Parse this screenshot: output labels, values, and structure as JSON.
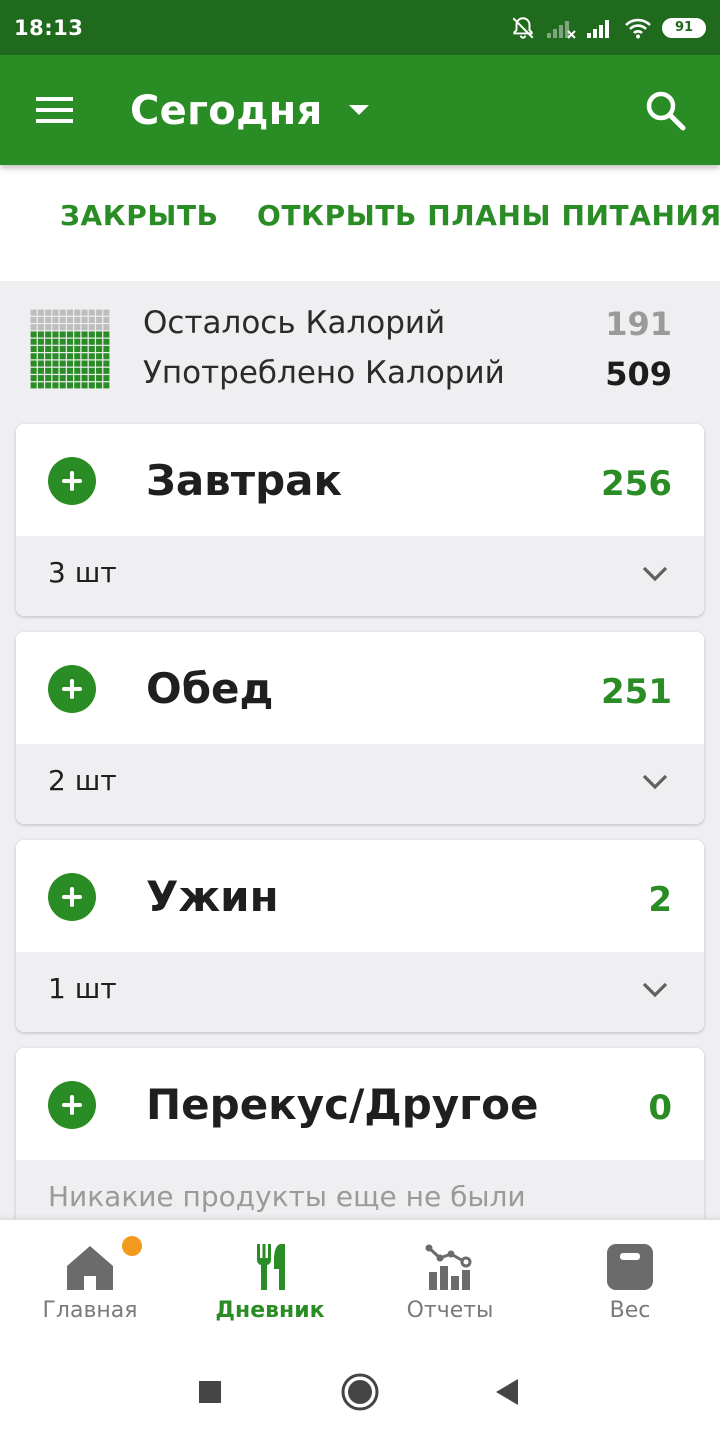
{
  "status_bar": {
    "time": "18:13",
    "battery": "91",
    "icons": [
      "bell-off-icon",
      "signal-weak-icon",
      "signal-icon",
      "wifi-icon",
      "battery-icon"
    ]
  },
  "app_bar": {
    "title": "Сегодня",
    "icons": [
      "menu-icon",
      "dropdown-arrow-icon",
      "search-icon"
    ]
  },
  "actions": {
    "close_label": "ЗАКРЫТЬ",
    "plans_label": "ОТКРЫТЬ ПЛАНЫ ПИТАНИЯ"
  },
  "summary": {
    "remaining_label": "Осталось Калорий",
    "remaining_value": "191",
    "consumed_label": "Употреблено Калорий",
    "consumed_value": "509",
    "grid_filled_fraction": 0.73
  },
  "meals": [
    {
      "name": "Завтрак",
      "calories": "256",
      "count": "3 шт"
    },
    {
      "name": "Обед",
      "calories": "251",
      "count": "2 шт"
    },
    {
      "name": "Ужин",
      "calories": "2",
      "count": "1 шт"
    },
    {
      "name": "Перекус/Другое",
      "calories": "0",
      "empty_text": "Никакие продукты еще не были"
    }
  ],
  "bottom_nav": {
    "items": [
      {
        "label": "Главная",
        "icon": "home-icon"
      },
      {
        "label": "Дневник",
        "icon": "utensils-icon"
      },
      {
        "label": "Отчеты",
        "icon": "reports-icon"
      },
      {
        "label": "Вес",
        "icon": "scale-icon"
      }
    ],
    "active_index": 1
  },
  "system_nav": {
    "icons": [
      "recents-icon",
      "home-circle-icon",
      "back-icon"
    ]
  },
  "colors": {
    "status_bar": "#1f6a1c",
    "app_bar": "#2a8c25",
    "accent": "#2a8c25",
    "badge": "#f39a1e",
    "background": "#efeef0"
  }
}
